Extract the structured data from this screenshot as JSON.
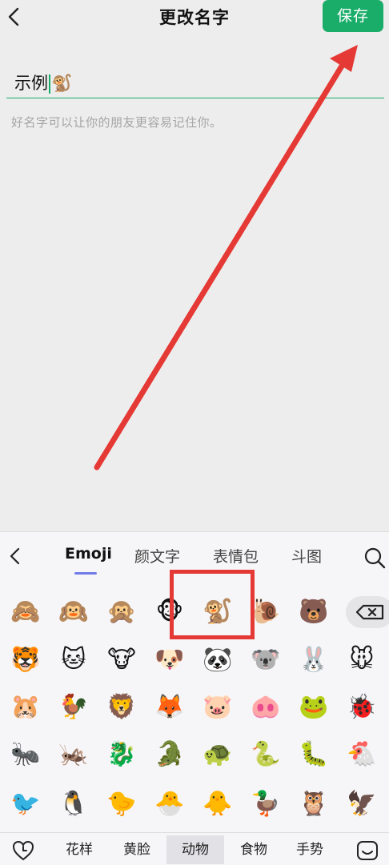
{
  "header": {
    "title": "更改名字",
    "save_label": "保存"
  },
  "name_field": {
    "text": "示例",
    "emoji": "🐒",
    "hint": "好名字可以让你的朋友更容易记住你。"
  },
  "keyboard": {
    "tabs": [
      {
        "label": "Emoji",
        "active": true
      },
      {
        "label": "颜文字",
        "active": false
      },
      {
        "label": "表情包",
        "active": false
      },
      {
        "label": "斗图",
        "active": false
      }
    ],
    "emoji_rows": [
      [
        "🙈",
        "🙉",
        "🙊",
        "🐵",
        "🐒",
        "🐌",
        "🐻"
      ],
      [
        "🐯",
        "🐱",
        "🐮",
        "🐶",
        "🐼",
        "🐨",
        "🐰",
        "🐭"
      ],
      [
        "🐹",
        "🐓",
        "🦁",
        "🦊",
        "🐷",
        "🐽",
        "🐸",
        "🐞"
      ],
      [
        "🐜",
        "🦗",
        "🐉",
        "🐊",
        "🐢",
        "🐍",
        "🐛",
        "🐔"
      ],
      [
        "🐦",
        "🐧",
        "🐤",
        "🐣",
        "🐥",
        "🦆",
        "🦉",
        "🦅"
      ]
    ],
    "categories": [
      {
        "label": "花样",
        "active": false
      },
      {
        "label": "黄脸",
        "active": false
      },
      {
        "label": "动物",
        "active": true
      },
      {
        "label": "食物",
        "active": false
      },
      {
        "label": "手势",
        "active": false
      }
    ]
  },
  "colors": {
    "accent": "#1aad6a",
    "annotation": "#e53935",
    "tab_indicator": "#6f7ce8"
  },
  "icons": [
    "back-icon",
    "search-icon",
    "backspace-icon",
    "heart-clock-icon",
    "keyboard-face-icon"
  ]
}
